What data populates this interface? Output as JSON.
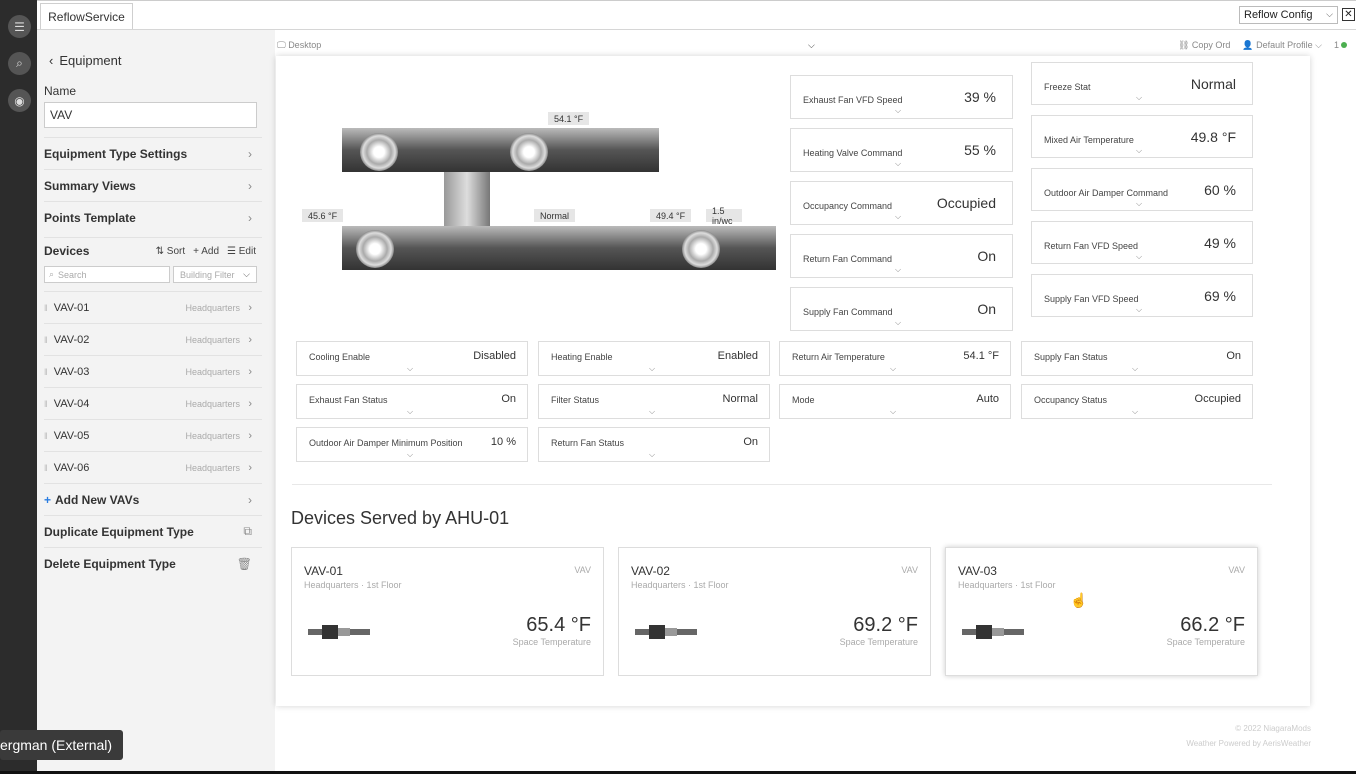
{
  "app": {
    "tab": "ReflowService",
    "config_select": "Reflow Config"
  },
  "rail_icons": [
    "menu-icon",
    "search-icon",
    "globe-icon"
  ],
  "sidebar": {
    "back_label": "Equipment",
    "name_label": "Name",
    "name_value": "VAV",
    "menu": [
      "Equipment Type Settings",
      "Summary Views",
      "Points Template"
    ],
    "devices_title": "Devices",
    "actions": {
      "sort": "Sort",
      "add": "Add",
      "edit": "Edit"
    },
    "search_placeholder": "Search",
    "building_filter": "Building Filter",
    "devices": [
      {
        "name": "VAV-01",
        "loc": "Headquarters"
      },
      {
        "name": "VAV-02",
        "loc": "Headquarters"
      },
      {
        "name": "VAV-03",
        "loc": "Headquarters"
      },
      {
        "name": "VAV-04",
        "loc": "Headquarters"
      },
      {
        "name": "VAV-05",
        "loc": "Headquarters"
      },
      {
        "name": "VAV-06",
        "loc": "Headquarters"
      }
    ],
    "add_new": "Add New VAVs",
    "duplicate": "Duplicate Equipment Type",
    "delete": "Delete Equipment Type"
  },
  "subbar": {
    "desktop": "Desktop",
    "copy": "Copy Ord",
    "profile": "Default Profile",
    "count": "1"
  },
  "diagram": {
    "return_temp": "54.1 °F",
    "outdoor_temp": "45.6 °F",
    "filter": "Normal",
    "mixed_temp": "49.4 °F",
    "pressure": "1.5 in/wc"
  },
  "big_points": [
    {
      "label": "Exhaust Fan VFD Speed",
      "value": "39 %"
    },
    {
      "label": "Heating Valve Command",
      "value": "55 %"
    },
    {
      "label": "Occupancy Command",
      "value": "Occupied"
    },
    {
      "label": "Return Fan Command",
      "value": "On"
    },
    {
      "label": "Supply Fan Command",
      "value": "On"
    },
    {
      "label": "Freeze Stat",
      "value": "Normal"
    },
    {
      "label": "Mixed Air Temperature",
      "value": "49.8 °F"
    },
    {
      "label": "Outdoor Air Damper Command",
      "value": "60 %"
    },
    {
      "label": "Return Fan VFD Speed",
      "value": "49 %"
    },
    {
      "label": "Supply Fan VFD Speed",
      "value": "69 %"
    }
  ],
  "small_points": [
    {
      "label": "Cooling Enable",
      "value": "Disabled"
    },
    {
      "label": "Heating Enable",
      "value": "Enabled"
    },
    {
      "label": "Return Air Temperature",
      "value": "54.1 °F"
    },
    {
      "label": "Supply Fan Status",
      "value": "On"
    },
    {
      "label": "Exhaust Fan Status",
      "value": "On"
    },
    {
      "label": "Filter Status",
      "value": "Normal"
    },
    {
      "label": "Mode",
      "value": "Auto"
    },
    {
      "label": "Occupancy Status",
      "value": "Occupied"
    },
    {
      "label": "Outdoor Air Damper Minimum Position",
      "value": "10 %"
    },
    {
      "label": "Return Fan Status",
      "value": "On"
    }
  ],
  "served": {
    "title": "Devices Served by AHU-01",
    "cards": [
      {
        "name": "VAV-01",
        "type": "VAV",
        "loc": "Headquarters",
        "floor": "1st Floor",
        "temp": "65.4 °F",
        "sub": "Space Temperature"
      },
      {
        "name": "VAV-02",
        "type": "VAV",
        "loc": "Headquarters",
        "floor": "1st Floor",
        "temp": "69.2 °F",
        "sub": "Space Temperature"
      },
      {
        "name": "VAV-03",
        "type": "VAV",
        "loc": "Headquarters",
        "floor": "1st Floor",
        "temp": "66.2 °F",
        "sub": "Space Temperature"
      }
    ]
  },
  "footer": {
    "copyright": "© 2022 NiagaraMods",
    "weather": "Weather Powered by AerisWeather"
  },
  "tooltip": "ergman (External)"
}
